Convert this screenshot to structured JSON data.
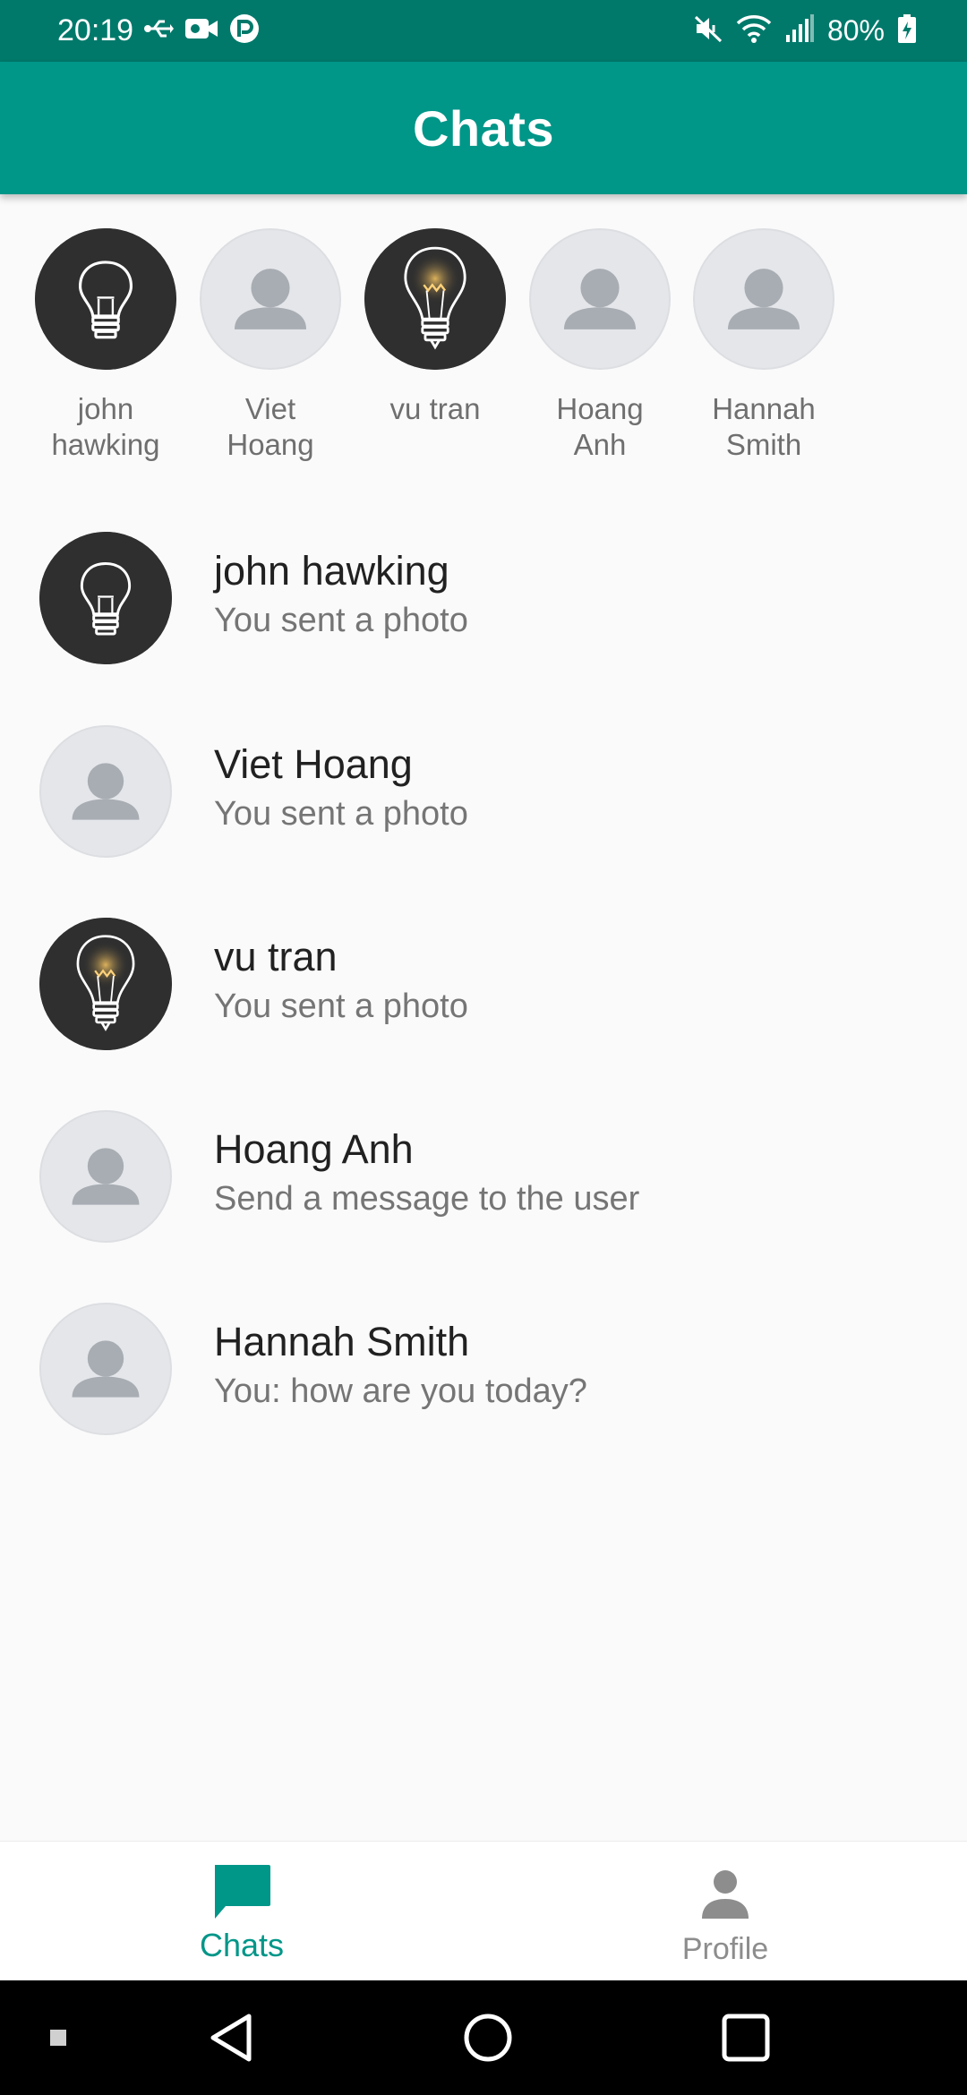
{
  "status_bar": {
    "time": "20:19",
    "battery": "80%",
    "left_icons": [
      "usb-icon",
      "video-record-icon",
      "app-notification-icon"
    ],
    "right_icons": [
      "mute-icon",
      "wifi-icon",
      "signal-icon",
      "battery-charging-icon"
    ]
  },
  "app_bar": {
    "title": "Chats"
  },
  "stories": [
    {
      "name": "john\nhawking",
      "avatar": "bulb-outline"
    },
    {
      "name": "Viet\nHoang",
      "avatar": "default-person"
    },
    {
      "name": "vu tran",
      "avatar": "bulb-glowing"
    },
    {
      "name": "Hoang\nAnh",
      "avatar": "default-person"
    },
    {
      "name": "Hannah\nSmith",
      "avatar": "default-person"
    }
  ],
  "chats": [
    {
      "name": "john hawking",
      "preview": "You sent a photo",
      "avatar": "bulb-outline"
    },
    {
      "name": "Viet Hoang",
      "preview": "You sent a photo",
      "avatar": "default-person"
    },
    {
      "name": "vu tran",
      "preview": "You sent a photo",
      "avatar": "bulb-glowing"
    },
    {
      "name": "Hoang Anh",
      "preview": "Send a message to the user",
      "avatar": "default-person"
    },
    {
      "name": "Hannah Smith",
      "preview": "You: how are you today?",
      "avatar": "default-person"
    }
  ],
  "bottom_nav": {
    "chats_label": "Chats",
    "profile_label": "Profile",
    "active": "Chats"
  },
  "colors": {
    "status_bar": "#00796b",
    "app_bar": "#009688",
    "accent": "#009688",
    "inactive": "#8d8d8d",
    "background": "#fafafa"
  }
}
